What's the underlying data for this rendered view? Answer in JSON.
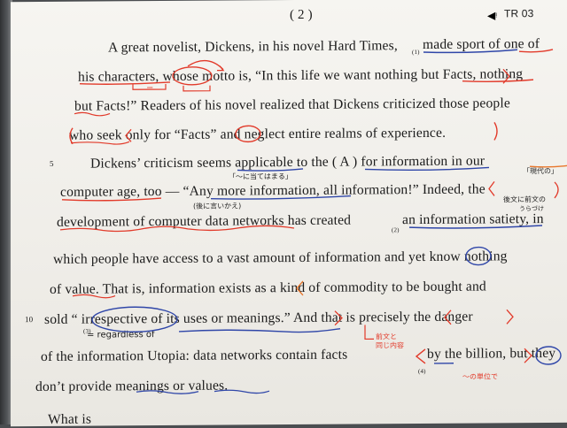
{
  "header": {
    "page_number": "( 2 )",
    "track": "TR 03",
    "speaker_icon": "speaker-icon"
  },
  "lines": [
    {
      "id": "l1",
      "text": "A great novelist, Dickens, in his novel Hard Times,"
    },
    {
      "id": "l1b",
      "text": "made sport of one of"
    },
    {
      "id": "l2",
      "text": "his characters, whose motto is, “In this life we want nothing but Facts, nothing"
    },
    {
      "id": "l3",
      "text": "but Facts!”  Readers of his novel realized that Dickens criticized those people"
    },
    {
      "id": "l4",
      "text": "who seek only for “Facts” and neglect entire realms of experience."
    },
    {
      "id": "l5",
      "text": "Dickens’ criticism seems applicable to the (    A    ) for information in our"
    },
    {
      "id": "l6",
      "text": "computer age, too — “Any more information, all information!”  Indeed, the"
    },
    {
      "id": "l7",
      "text": "development of computer data networks has created"
    },
    {
      "id": "l7b",
      "text": "an information satiety, in"
    },
    {
      "id": "l8",
      "text": "which people have access to a vast amount of information and yet know nothing"
    },
    {
      "id": "l9",
      "text": "of value.  That is, information exists as a kind of commodity to be bought and"
    },
    {
      "id": "l10",
      "text": "sold “ irrespective of its uses or meanings.”  And that is precisely the danger"
    },
    {
      "id": "l11",
      "text": "of the information Utopia: data networks contain facts"
    },
    {
      "id": "l11b",
      "text": "by the billion, but they"
    },
    {
      "id": "l12",
      "text": "don’t provide meanings or values."
    },
    {
      "id": "l13",
      "text": "What is"
    }
  ],
  "line_numbers": {
    "five": "5",
    "ten": "10"
  },
  "underline_marks": {
    "m1": "(1)",
    "m2": "(2)",
    "m3": "(3)",
    "m4": "(4)"
  },
  "annotations": {
    "a_note": "「～に当てはまる」",
    "sokohen": "「現代の」",
    "iikae": "(後に言いかえ)",
    "zenbun": "後文に前文の",
    "urazuke": "うらづけ",
    "regardless": "= regardless  of",
    "zenbun2": "前文と",
    "onaji": "同じ内容",
    "tani": "～の単位で",
    "equals": "="
  }
}
